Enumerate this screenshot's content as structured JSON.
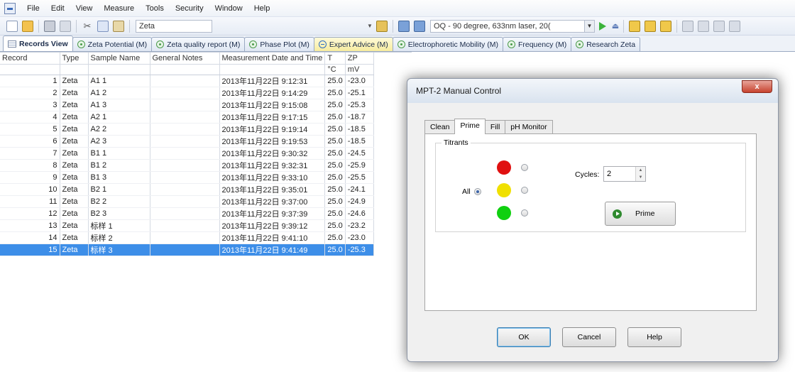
{
  "menu": [
    "File",
    "Edit",
    "View",
    "Measure",
    "Tools",
    "Security",
    "Window",
    "Help"
  ],
  "toolbar": {
    "zeta_field": "Zeta",
    "sop_select": "OQ - 90 degree, 633nm laser, 20("
  },
  "tabs": [
    {
      "label": "Records View",
      "icon": "grid-icon",
      "active": true
    },
    {
      "label": "Zeta Potential (M)",
      "icon": "report-icon"
    },
    {
      "label": "Zeta quality report (M)",
      "icon": "report-icon"
    },
    {
      "label": "Phase Plot (M)",
      "icon": "report-icon"
    },
    {
      "label": "Expert Advice (M)",
      "icon": "minus-circle-icon",
      "highlight": true
    },
    {
      "label": "Electrophoretic Mobility (M)",
      "icon": "report-icon"
    },
    {
      "label": "Frequency (M)",
      "icon": "report-icon"
    },
    {
      "label": "Research Zeta",
      "icon": "report-icon"
    }
  ],
  "table": {
    "headers": [
      "Record",
      "Type",
      "Sample Name",
      "General Notes",
      "Measurement Date and Time",
      "T",
      "ZP"
    ],
    "units": [
      "",
      "",
      "",
      "",
      "",
      "°C",
      "mV"
    ],
    "rows": [
      [
        "1",
        "Zeta",
        "A1 1",
        "",
        "2013年11月22日 9:12:31",
        "25.0",
        "-23.0"
      ],
      [
        "2",
        "Zeta",
        "A1 2",
        "",
        "2013年11月22日 9:14:29",
        "25.0",
        "-25.1"
      ],
      [
        "3",
        "Zeta",
        "A1 3",
        "",
        "2013年11月22日 9:15:08",
        "25.0",
        "-25.3"
      ],
      [
        "4",
        "Zeta",
        "A2 1",
        "",
        "2013年11月22日 9:17:15",
        "25.0",
        "-18.7"
      ],
      [
        "5",
        "Zeta",
        "A2 2",
        "",
        "2013年11月22日 9:19:14",
        "25.0",
        "-18.5"
      ],
      [
        "6",
        "Zeta",
        "A2 3",
        "",
        "2013年11月22日 9:19:53",
        "25.0",
        "-18.5"
      ],
      [
        "7",
        "Zeta",
        "B1 1",
        "",
        "2013年11月22日 9:30:32",
        "25.0",
        "-24.5"
      ],
      [
        "8",
        "Zeta",
        "B1 2",
        "",
        "2013年11月22日 9:32:31",
        "25.0",
        "-25.9"
      ],
      [
        "9",
        "Zeta",
        "B1 3",
        "",
        "2013年11月22日 9:33:10",
        "25.0",
        "-25.5"
      ],
      [
        "10",
        "Zeta",
        "B2 1",
        "",
        "2013年11月22日 9:35:01",
        "25.0",
        "-24.1"
      ],
      [
        "11",
        "Zeta",
        "B2 2",
        "",
        "2013年11月22日 9:37:00",
        "25.0",
        "-24.9"
      ],
      [
        "12",
        "Zeta",
        "B2 3",
        "",
        "2013年11月22日 9:37:39",
        "25.0",
        "-24.6"
      ],
      [
        "13",
        "Zeta",
        "标样 1",
        "",
        "2013年11月22日 9:39:12",
        "25.0",
        "-23.2"
      ],
      [
        "14",
        "Zeta",
        "标样 2",
        "",
        "2013年11月22日 9:41:10",
        "25.0",
        "-23.0"
      ],
      [
        "15",
        "Zeta",
        "标样 3",
        "",
        "2013年11月22日 9:41:49",
        "25.0",
        "-25.3"
      ]
    ],
    "selected_row": 14
  },
  "dialog": {
    "title": "MPT-2 Manual Control",
    "close_label": "x",
    "tabs": [
      "Clean",
      "Prime",
      "Fill",
      "pH Monitor"
    ],
    "active_tab": "Prime",
    "titrants_label": "Titrants",
    "all_label": "All",
    "dot_colors": [
      "#e01010",
      "#f0e000",
      "#10d010"
    ],
    "cycles_label": "Cycles:",
    "cycles_value": "2",
    "prime_label": "Prime",
    "buttons": {
      "ok": "OK",
      "cancel": "Cancel",
      "help": "Help"
    }
  }
}
